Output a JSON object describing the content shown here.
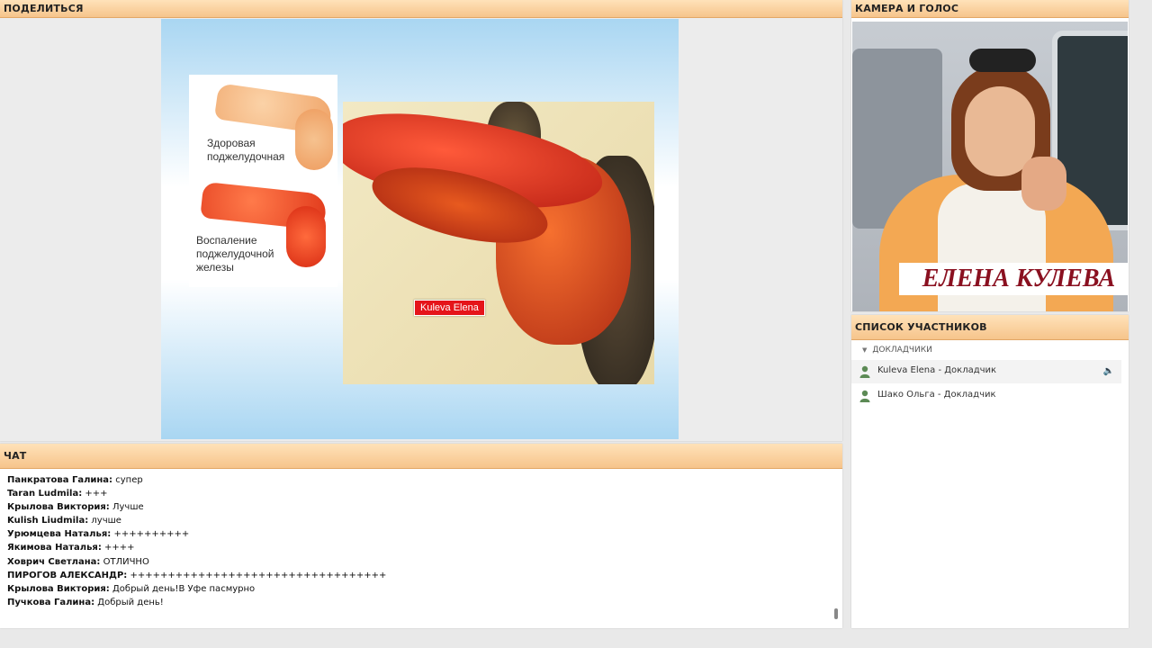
{
  "share": {
    "title": "ПОДЕЛИТЬСЯ"
  },
  "slide": {
    "label_healthy": "Здоровая поджелудочная",
    "label_inflamed": "Воспаление поджелудочной железы",
    "presenter_tag": "Kuleva Elena"
  },
  "camera": {
    "title": "КАМЕРА И ГОЛОС",
    "name_banner": "ЕЛЕНА КУЛЕВА"
  },
  "participants": {
    "title": "СПИСОК УЧАСТНИКОВ",
    "group": "ДОКЛАДЧИКИ",
    "items": [
      {
        "label": "Kuleva Elena - Докладчик",
        "icon": "user-icon",
        "status_icon": "speaker-icon"
      },
      {
        "label": "Шако Ольга - Докладчик",
        "icon": "user-icon"
      }
    ]
  },
  "chat": {
    "title": "ЧАТ",
    "messages": [
      {
        "author": "Панкратова Галина:",
        "text": "супер"
      },
      {
        "author": "Taran Ludmila:",
        "text": "+++"
      },
      {
        "author": "Крылова Виктория:",
        "text": "Лучше"
      },
      {
        "author": "Kulish Liudmila:",
        "text": "лучше"
      },
      {
        "author": "Урюмцева Наталья:",
        "text": "++++++++++"
      },
      {
        "author": "Якимова Наталья:",
        "text": "++++"
      },
      {
        "author": "Ховрич Светлана:",
        "text": "ОТЛИЧНО"
      },
      {
        "author": "ПИРОГОВ АЛЕКСАНДР:",
        "text": "++++++++++++++++++++++++++++++++++"
      },
      {
        "author": "Крылова Виктория:",
        "text": "Добрый день!В Уфе пасмурно"
      },
      {
        "author": "Пучкова Галина:",
        "text": "Добрый день!"
      }
    ]
  }
}
